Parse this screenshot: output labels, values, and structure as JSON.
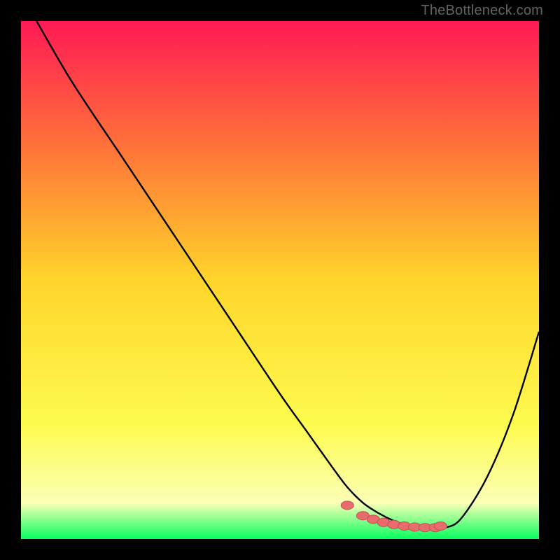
{
  "watermark": "TheBottleneck.com",
  "colors": {
    "background": "#000000",
    "gradient_top": "#ff1a55",
    "gradient_mid_upper": "#ff6a3b",
    "gradient_mid": "#ffd52a",
    "gradient_mid_lower": "#fdfb4f",
    "gradient_lower": "#fbffb6",
    "gradient_bottom": "#07ff5e",
    "curve": "#000000",
    "marker_fill": "#e86c6c",
    "marker_stroke": "#c24f4f",
    "watermark": "#636363"
  },
  "chart_data": {
    "type": "line",
    "title": "",
    "xlabel": "",
    "ylabel": "",
    "xlim": [
      0,
      100
    ],
    "ylim": [
      0,
      100
    ],
    "grid": false,
    "legend": false,
    "series": [
      {
        "name": "curve",
        "x": [
          3,
          10,
          20,
          30,
          40,
          50,
          55,
          60,
          63,
          66,
          69,
          72,
          75,
          78,
          80,
          82,
          85,
          90,
          95,
          100
        ],
        "y": [
          100,
          88,
          73,
          58,
          43,
          28,
          21,
          14,
          10,
          7,
          5,
          3.5,
          2.5,
          2,
          2,
          2.2,
          4,
          12,
          24,
          40
        ]
      }
    ],
    "markers": {
      "name": "highlighted-range",
      "x": [
        63,
        66,
        68,
        70,
        72,
        74,
        76,
        78,
        80,
        81
      ],
      "y": [
        6.5,
        4.5,
        3.8,
        3.2,
        2.8,
        2.5,
        2.3,
        2.2,
        2.2,
        2.5
      ]
    }
  }
}
